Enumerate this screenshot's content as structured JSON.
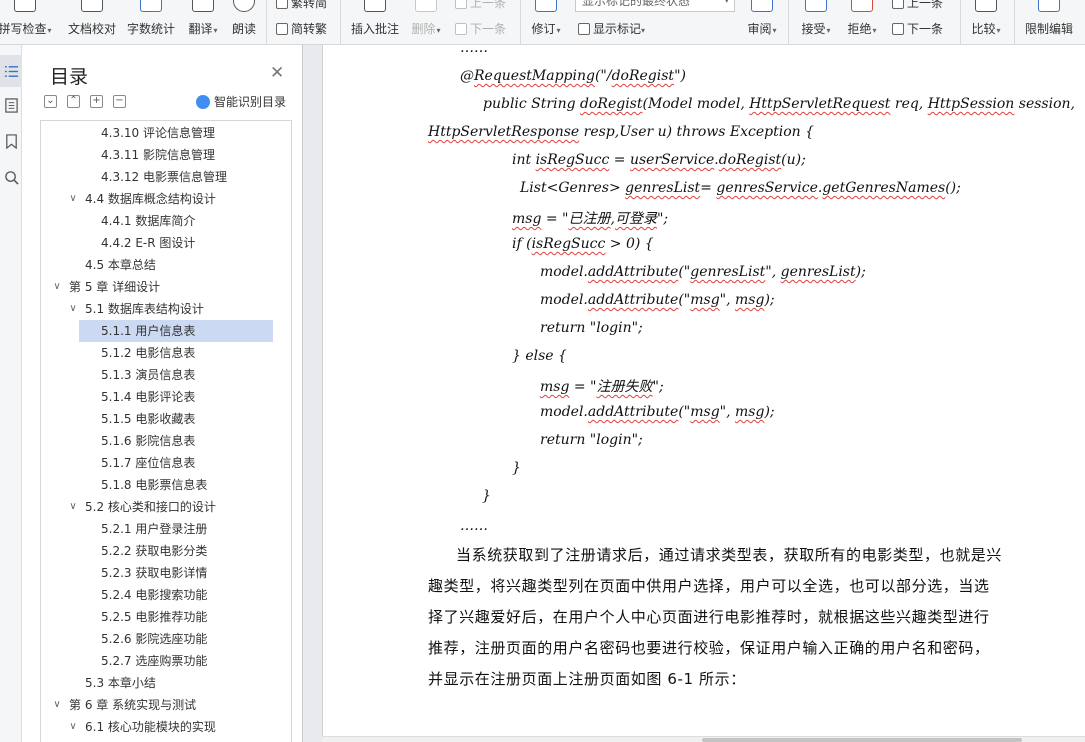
{
  "ribbon": {
    "spellcheck": "拼写检查",
    "proofread": "文档校对",
    "wordcount": "字数统计",
    "translate": "翻译",
    "read_aloud": "朗读",
    "trad_chinese": "繁转简",
    "simp_chinese": "简转繁",
    "insert_comment": "插入批注",
    "delete": "删除",
    "prev_item": "上一条",
    "next_item": "下一条",
    "track_changes": "修订",
    "markup_mode": "显示标记的最终状态",
    "show_markup": "显示标记",
    "review": "审阅",
    "accept": "接受",
    "reject": "拒绝",
    "prev_change": "上一条",
    "next_change": "下一条",
    "compare": "比较",
    "restrict_editing": "限制编辑"
  },
  "toc": {
    "title": "目录",
    "smart_label": "智能识别目录",
    "items": [
      {
        "label": "4.3.10  评论信息管理",
        "level": 3
      },
      {
        "label": "4.3.11  影院信息管理",
        "level": 3
      },
      {
        "label": "4.3.12  电影票信息管理",
        "level": 3
      },
      {
        "label": "4.4  数据库概念结构设计",
        "level": 2,
        "toggle": "∨"
      },
      {
        "label": "4.4.1  数据库简介",
        "level": 3
      },
      {
        "label": "4.4.2  E-R 图设计",
        "level": 3
      },
      {
        "label": "4.5  本章总结",
        "level": 2
      },
      {
        "label": "第 5 章  详细设计",
        "level": 1,
        "toggle": "∨"
      },
      {
        "label": "5.1  数据库表结构设计",
        "level": 2,
        "toggle": "∨"
      },
      {
        "label": "5.1.1  用户信息表",
        "level": 3,
        "selected": true
      },
      {
        "label": "5.1.2  电影信息表",
        "level": 3
      },
      {
        "label": "5.1.3  演员信息表",
        "level": 3
      },
      {
        "label": "5.1.4  电影评论表",
        "level": 3
      },
      {
        "label": "5.1.5  电影收藏表",
        "level": 3
      },
      {
        "label": "5.1.6  影院信息表",
        "level": 3
      },
      {
        "label": "5.1.7  座位信息表",
        "level": 3
      },
      {
        "label": "5.1.8  电影票信息表",
        "level": 3
      },
      {
        "label": "5.2  核心类和接口的设计",
        "level": 2,
        "toggle": "∨"
      },
      {
        "label": "5.2.1  用户登录注册",
        "level": 3
      },
      {
        "label": "5.2.2  获取电影分类",
        "level": 3
      },
      {
        "label": "5.2.3  获取电影详情",
        "level": 3
      },
      {
        "label": "5.2.4  电影搜索功能",
        "level": 3
      },
      {
        "label": "5.2.5  电影推荐功能",
        "level": 3
      },
      {
        "label": "5.2.6  影院选座功能",
        "level": 3
      },
      {
        "label": "5.2.7  选座购票功能",
        "level": 3
      },
      {
        "label": "5.3  本章小结",
        "level": 2
      },
      {
        "label": "第 6 章  系统实现与测试",
        "level": 1,
        "toggle": "∨"
      },
      {
        "label": "6.1  核心功能模块的实现",
        "level": 2,
        "toggle": "∨"
      }
    ]
  },
  "document": {
    "code": [
      {
        "indent": 0,
        "text": "……"
      },
      {
        "indent": 0,
        "text": "@RequestMapping(\"/doRegist\")"
      },
      {
        "indent": 1,
        "text": "public String doRegist(Model model, HttpServletRequest req, HttpSession session,"
      },
      {
        "indent": -1,
        "text": "HttpServletResponse resp,User u) throws Exception {"
      },
      {
        "indent": 2,
        "text": "int isRegSucc = userService.doRegist(u);"
      },
      {
        "indent": 3,
        "text": "List<Genres> genresList=    genresService.getGenresNames();"
      },
      {
        "indent": 2,
        "text": "msg = \"已注册,可登录\";"
      },
      {
        "indent": 2,
        "text": "if (isRegSucc > 0) {"
      },
      {
        "indent": 4,
        "text": "model.addAttribute(\"genresList\", genresList);"
      },
      {
        "indent": 4,
        "text": "model.addAttribute(\"msg\", msg);"
      },
      {
        "indent": 4,
        "text": "return \"login\";"
      },
      {
        "indent": 2,
        "text": "} else {"
      },
      {
        "indent": 4,
        "text": "msg = \"注册失败\";"
      },
      {
        "indent": 4,
        "text": "model.addAttribute(\"msg\", msg);"
      },
      {
        "indent": 4,
        "text": "return \"login\";"
      },
      {
        "indent": 2,
        "text": "}"
      },
      {
        "indent": 5,
        "text": "}"
      },
      {
        "indent": 0,
        "text": "……"
      }
    ],
    "paragraph": [
      "当系统获取到了注册请求后，通过请求类型表，获取所有的电影类型，也就是兴",
      "趣类型，将兴趣类型列在页面中供用户选择，用户可以全选，也可以部分选，当选",
      "择了兴趣爱好后，在用户个人中心页面进行电影推荐时，就根据这些兴趣类型进行",
      "推荐，注册页面的用户名密码也要进行校验，保证用户输入正确的用户名和密码，",
      "并显示在注册页面上注册页面如图 6-1 所示："
    ]
  }
}
